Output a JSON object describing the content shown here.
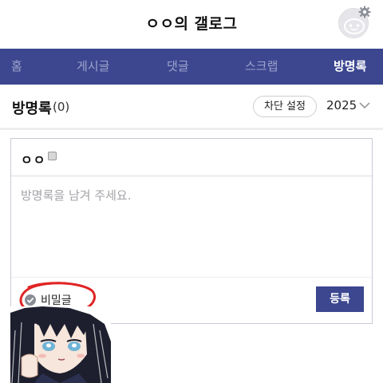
{
  "header": {
    "gallog_title": "ㅇㅇ의 갤로그",
    "avatar": "default-profile-avatar",
    "settings_icon": "gear-icon"
  },
  "tabs": [
    {
      "label": "홈",
      "active": false
    },
    {
      "label": "게시글",
      "active": false
    },
    {
      "label": "댓글",
      "active": false
    },
    {
      "label": "스크랩",
      "active": false
    },
    {
      "label": "방명록",
      "active": true
    }
  ],
  "guestbook": {
    "title": "방명록",
    "count": "(0)",
    "block_settings_label": "차단 설정",
    "year_selected": "2025",
    "year_chevron": "chevron-down-icon"
  },
  "write_form": {
    "nickname": "ㅇㅇ",
    "nickname_badge_icon": "fluid-nick-icon",
    "memo_placeholder": "방명록을 남겨 주세요.",
    "secret_label": "비밀글",
    "secret_check_icon": "check-circle-icon",
    "submit_label": "등록"
  },
  "colors": {
    "tabbar_bg": "#3c4790",
    "tab_inactive": "#9ea3cc",
    "tab_active": "#ffffff",
    "submit_bg": "#3c4790",
    "annotation_red": "#e02424"
  },
  "overlay": {
    "sticker": "anime-character-sticker",
    "annotation": "hand-drawn-red-circle"
  }
}
